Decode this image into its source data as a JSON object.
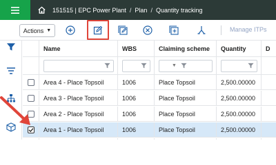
{
  "topbar": {
    "menu_icon": "hamburger-icon",
    "home_icon": "home-icon",
    "breadcrumb": [
      "151515 | EPC Power Plant",
      "Plan",
      "Quantity tracking"
    ],
    "separator": "/"
  },
  "toolbar": {
    "actions_label": "Actions",
    "icons": [
      "add-circle-icon",
      "edit-icon",
      "bulk-edit-icon",
      "remove-circle-icon",
      "add-group-icon",
      "split-icon"
    ],
    "manage_itps_label": "Manage ITPs"
  },
  "rail": {
    "icons": [
      "filter-funnel-icon",
      "filter-lines-icon",
      "hierarchy-icon",
      "package-icon"
    ]
  },
  "grid": {
    "columns": [
      "",
      "Name",
      "WBS",
      "Claiming scheme",
      "Quantity",
      "D"
    ],
    "rows": [
      {
        "checked": false,
        "name": "Area 4 - Place Topsoil",
        "wbs": "1006",
        "scheme": "Place Topsoil",
        "quantity": "2,500.00000"
      },
      {
        "checked": false,
        "name": "Area 3 - Place Topsoil",
        "wbs": "1006",
        "scheme": "Place Topsoil",
        "quantity": "2,500.00000"
      },
      {
        "checked": false,
        "name": "Area 2 - Place Topsoil",
        "wbs": "1006",
        "scheme": "Place Topsoil",
        "quantity": "2,500.00000"
      },
      {
        "checked": true,
        "name": "Area 1 - Place Topsoil",
        "wbs": "1006",
        "scheme": "Place Topsoil",
        "quantity": "2,500.00000"
      }
    ]
  },
  "colors": {
    "topbar_bg": "#2c3a37",
    "menu_green": "#16a34a",
    "accent_blue": "#1d5fa8",
    "highlight_red": "#e0453a",
    "selected_row": "#d6e8f8"
  }
}
